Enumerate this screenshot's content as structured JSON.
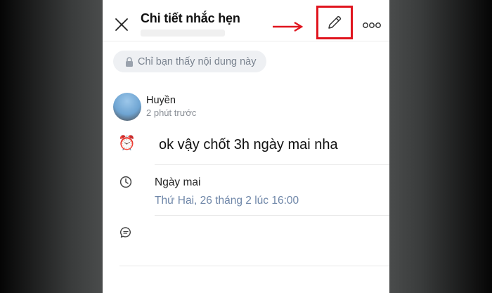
{
  "header": {
    "title": "Chi tiết nhắc hẹn"
  },
  "privacy": {
    "label": "Chỉ bạn thấy nội dung này"
  },
  "author": {
    "name": "Huyền",
    "time": "2 phút trước"
  },
  "reminder": {
    "emoji": "⏰",
    "text": "ok vậy chốt 3h ngày mai nha"
  },
  "schedule": {
    "day": "Ngày mai",
    "detail": "Thứ Hai, 26 tháng 2 lúc 16:00"
  },
  "icons": {
    "close": "close-icon",
    "edit": "pencil-icon",
    "more": "more-icon",
    "lock": "lock-icon",
    "clock": "clock-icon",
    "comment": "comment-icon",
    "arrow": "red-arrow-icon"
  },
  "colors": {
    "highlight": "#e0141e",
    "date_detail": "#6e86a8",
    "pill_bg": "#eef0f3"
  }
}
